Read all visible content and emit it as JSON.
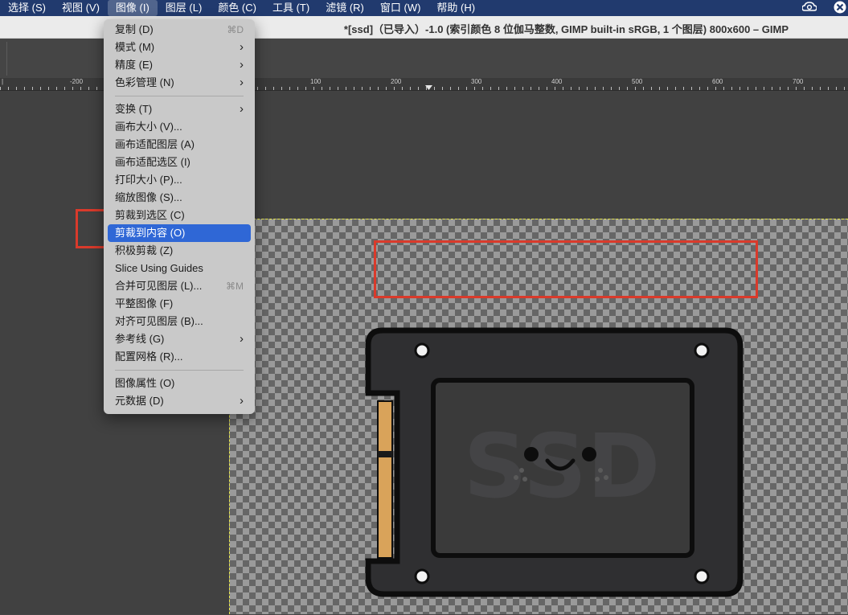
{
  "menubar": {
    "items": [
      "选择 (S)",
      "视图 (V)",
      "图像 (I)",
      "图层 (L)",
      "颜色 (C)",
      "工具 (T)",
      "滤镜 (R)",
      "窗口 (W)",
      "帮助 (H)"
    ],
    "active_index": 2,
    "right_icons": [
      "creative-cloud-icon",
      "app-status-icon"
    ]
  },
  "window": {
    "title": "*[ssd]（已导入）-1.0 (索引颜色 8 位伽马整数, GIMP built-in sRGB, 1 个图层) 800x600 – GIMP"
  },
  "ruler": {
    "labels": [
      "-200",
      "100",
      "200",
      "300",
      "400",
      "500",
      "600",
      "700"
    ]
  },
  "image_menu": {
    "items": [
      {
        "label": "复制 (D)",
        "shortcut": "⌘D"
      },
      {
        "label": "模式 (M)",
        "submenu": true
      },
      {
        "label": "精度 (E)",
        "submenu": true
      },
      {
        "label": "色彩管理 (N)",
        "submenu": true
      },
      {
        "separator": true
      },
      {
        "label": "变换 (T)",
        "submenu": true
      },
      {
        "label": "画布大小 (V)..."
      },
      {
        "label": "画布适配图层 (A)"
      },
      {
        "label": "画布适配选区 (I)"
      },
      {
        "label": "打印大小 (P)..."
      },
      {
        "label": "缩放图像 (S)..."
      },
      {
        "label": "剪裁到选区 (C)"
      },
      {
        "label": "剪裁到内容 (O)",
        "highlighted": true
      },
      {
        "label": "积极剪裁 (Z)"
      },
      {
        "label": "Slice Using Guides"
      },
      {
        "label": "合并可见图层 (L)...",
        "shortcut": "⌘M"
      },
      {
        "label": "平整图像 (F)"
      },
      {
        "label": "对齐可见图层 (B)..."
      },
      {
        "label": "参考线 (G)",
        "submenu": true
      },
      {
        "label": "配置网格 (R)..."
      },
      {
        "separator": true
      },
      {
        "label": "图像属性 (O)"
      },
      {
        "label": "元数据 (D)",
        "submenu": true
      }
    ]
  },
  "colors": {
    "menubar_bg": "#213a6e",
    "highlight": "#2f67d6",
    "annotation_red": "#d93a2b",
    "ssd_body": "#2f2f31",
    "ssd_connector": "#d9a35a"
  }
}
